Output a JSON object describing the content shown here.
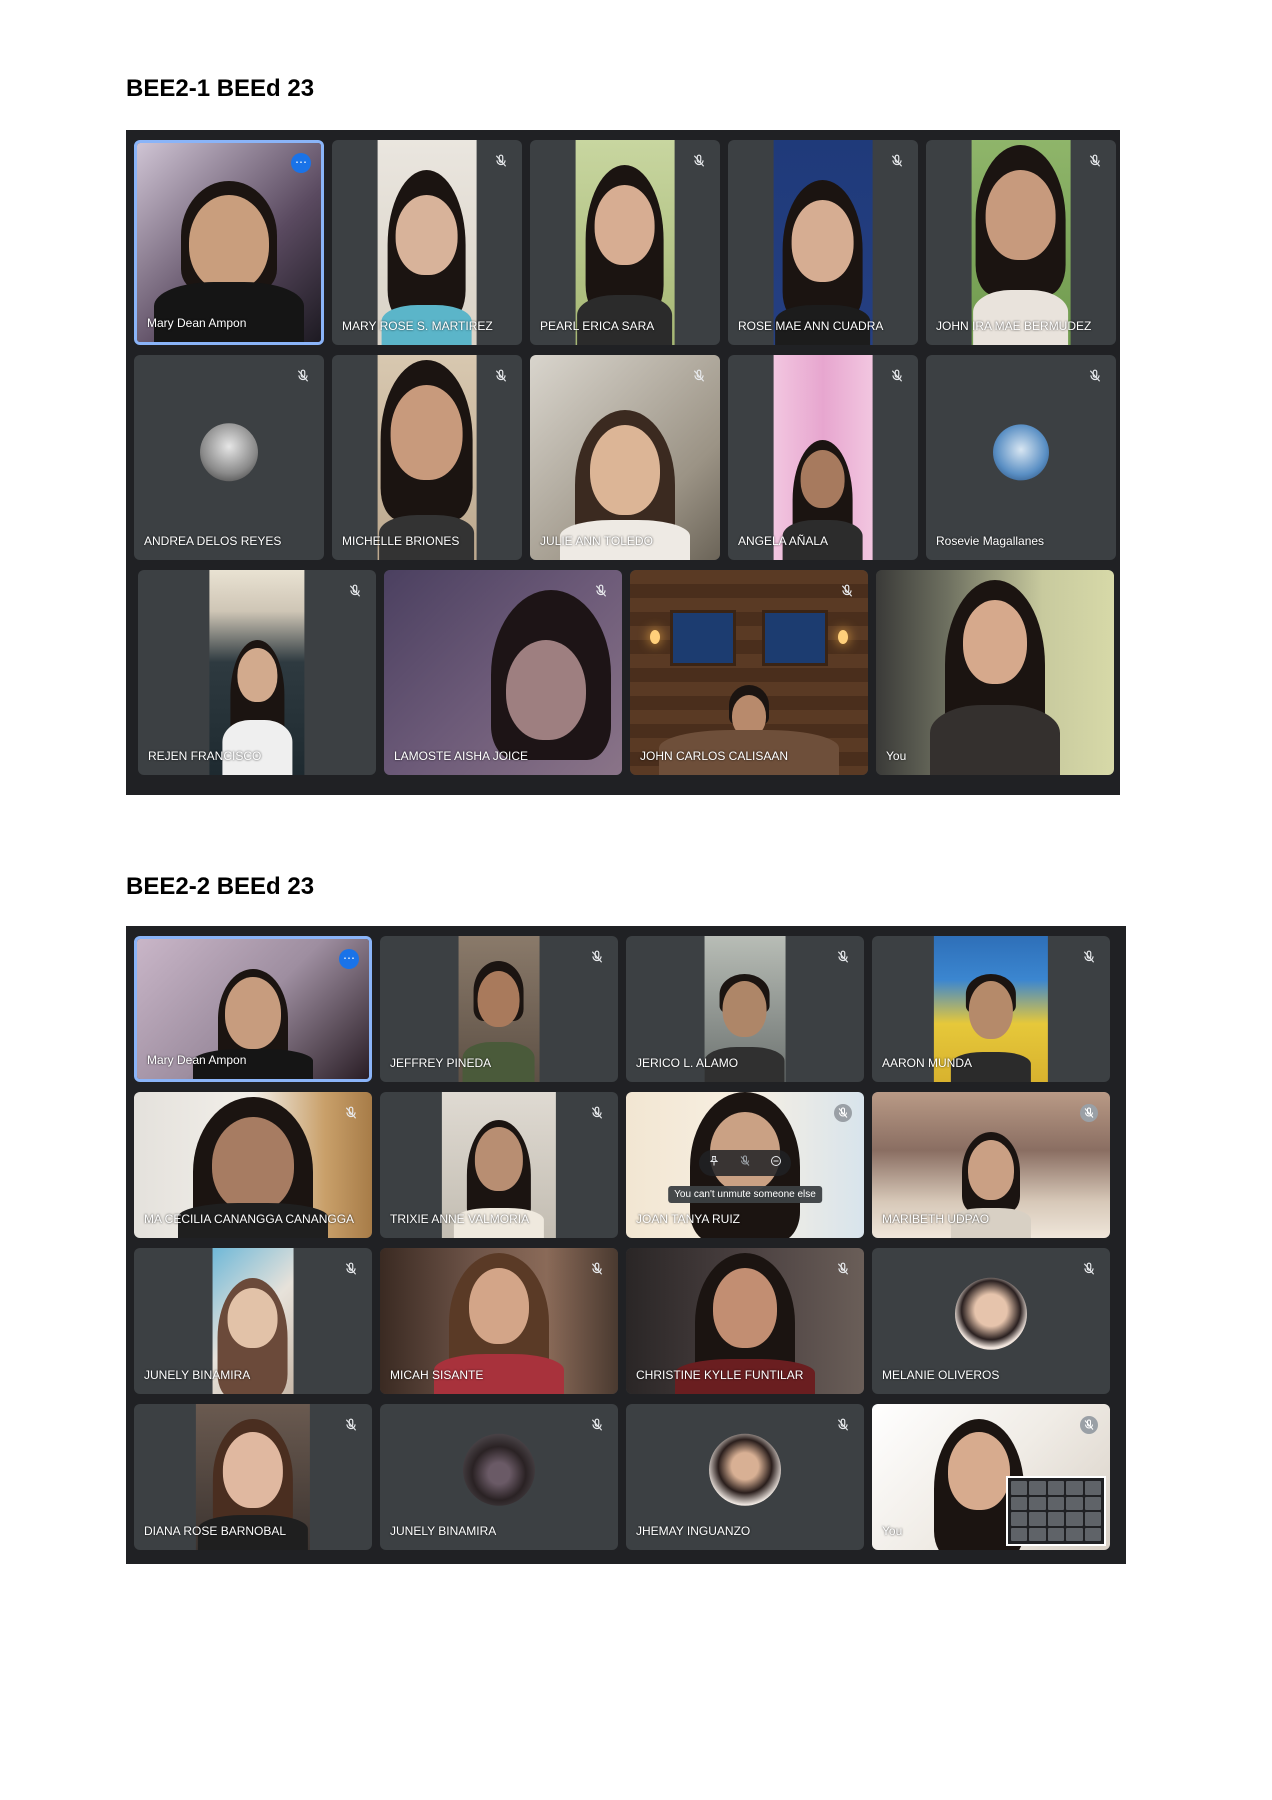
{
  "sections": [
    {
      "title": "BEE2-1  BEEd 23",
      "participants": [
        "Mary Dean Ampon",
        "MARY ROSE S. MARTIREZ",
        "PEARL ERICA SARA",
        "ROSE MAE ANN CUADRA",
        "JOHN IRA MAE BERMUDEZ",
        "ANDREA DELOS REYES",
        "MICHELLE BRIONES",
        "JULIE ANN TOLEDO",
        "ANGELA AÑALA",
        "Rosevie Magallanes",
        "REJEN FRANCISCO",
        "LAMOSTE AISHA JOICE",
        "JOHN CARLOS CALISAAN",
        "You"
      ]
    },
    {
      "title": "BEE2-2 BEEd 23",
      "participants": [
        "Mary Dean Ampon",
        "JEFFREY PINEDA",
        "JERICO L. ALAMO",
        "AARON MUNDA",
        "MA CECILIA CANANGGA CANANGGA",
        "TRIXIE ANNE VALMORIA",
        "JOAN TANYA RUIZ",
        "MARIBETH UDPAO",
        "JUNELY BINAMIRA",
        "MICAH SISANTE",
        "CHRISTINE KYLLE FUNTILAR",
        "MELANIE OLIVEROS",
        "DIANA ROSE BARNOBAL",
        "JUNELY BINAMIRA",
        "JHEMAY INGUANZO",
        "You"
      ],
      "tooltip": "You can't unmute someone else"
    }
  ],
  "colors": {
    "meet_background": "#202124",
    "tile_background": "#3c4043",
    "active_speaker_border": "#8ab4f8",
    "more_options_button": "#1a73e8"
  },
  "icons": {
    "mute": "mic-off-icon",
    "more": "more-options-icon",
    "pin": "pin-icon",
    "remove": "remove-icon"
  }
}
